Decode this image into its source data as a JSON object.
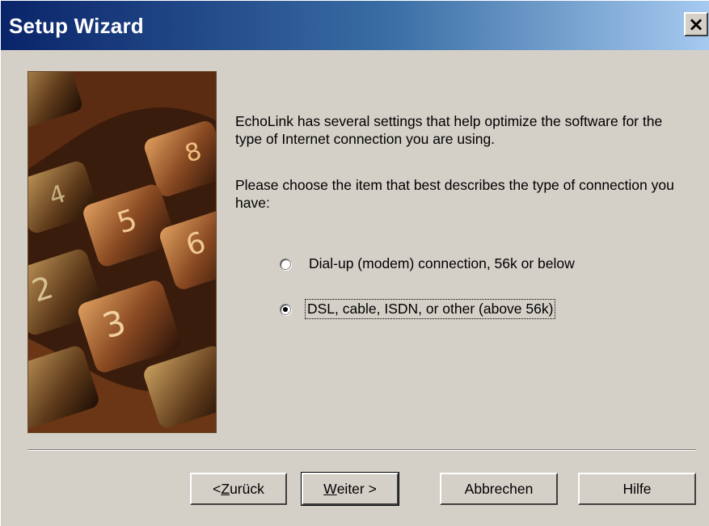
{
  "window": {
    "title": "Setup Wizard",
    "close_symbol": "×"
  },
  "content": {
    "paragraph1": "EchoLink has several settings that help optimize the software for the type of Internet connection you are using.",
    "paragraph2": "Please choose the item that best describes the type of connection you have:",
    "options": [
      {
        "label": "Dial-up (modem) connection, 56k or below",
        "selected": false
      },
      {
        "label": "DSL, cable, ISDN, or other (above 56k)",
        "selected": true
      }
    ]
  },
  "buttons": {
    "back": "< Zurück",
    "next": "Weiter >",
    "cancel": "Abbrechen",
    "help": "Hilfe"
  },
  "image": {
    "description_icon": "keypad-photo",
    "key_labels": [
      "4",
      "5",
      "6",
      "2",
      "3",
      "8"
    ]
  },
  "colors": {
    "titlebar_start": "#0a246a",
    "titlebar_end": "#a6caf0",
    "dialog_bg": "#d4d0c8"
  }
}
